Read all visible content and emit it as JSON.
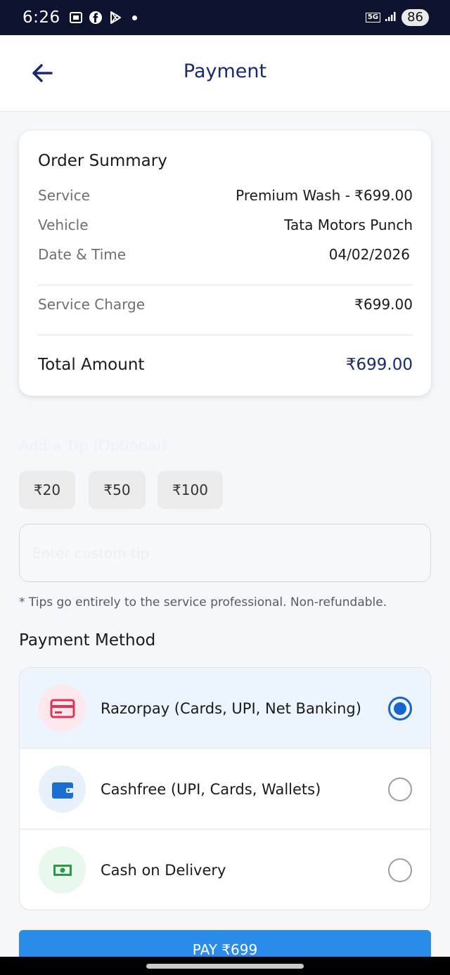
{
  "status_bar": {
    "time": "6:26",
    "network": "5G",
    "battery": "86",
    "icons": [
      "screenshot-icon",
      "facebook-icon",
      "play-store-icon",
      "notification-dot-icon",
      "signal-icon"
    ]
  },
  "header": {
    "title": "Payment",
    "back_icon": "arrow-left-icon"
  },
  "order_summary": {
    "title": "Order Summary",
    "rows": [
      {
        "label": "Service",
        "value": "Premium Wash - ₹699.00"
      },
      {
        "label": "Vehicle",
        "value": "Tata Motors Punch"
      },
      {
        "label": "Date & Time",
        "value": "04/02/2026"
      }
    ],
    "service_charge": {
      "label": "Service Charge",
      "value": "₹699.00"
    },
    "total": {
      "label": "Total Amount",
      "value": "₹699.00"
    }
  },
  "tip": {
    "label": "Add a Tip (Optional)",
    "options": [
      "₹20",
      "₹50",
      "₹100"
    ],
    "custom_placeholder": "Enter custom tip",
    "note": "* Tips go entirely to the service professional. Non-refundable."
  },
  "payment_method": {
    "title": "Payment Method",
    "options": [
      {
        "label": "Razorpay (Cards, UPI, Net Banking)",
        "icon": "credit-card-icon",
        "selected": true,
        "icon_color": "#e0335a",
        "icon_bg": "#fde8ee"
      },
      {
        "label": "Cashfree (UPI, Cards, Wallets)",
        "icon": "wallet-icon",
        "selected": false,
        "icon_color": "#1a6fd1",
        "icon_bg": "#e6f1fc"
      },
      {
        "label": "Cash on Delivery",
        "icon": "cash-icon",
        "selected": false,
        "icon_color": "#2a9a4a",
        "icon_bg": "#e8f8ec"
      }
    ]
  },
  "pay_button": {
    "label": "PAY ₹699"
  },
  "colors": {
    "accent": "#1b2a6b",
    "primary_button": "#2a8ce8",
    "radio_selected": "#1766c9",
    "status_bar": "#0e1330"
  }
}
